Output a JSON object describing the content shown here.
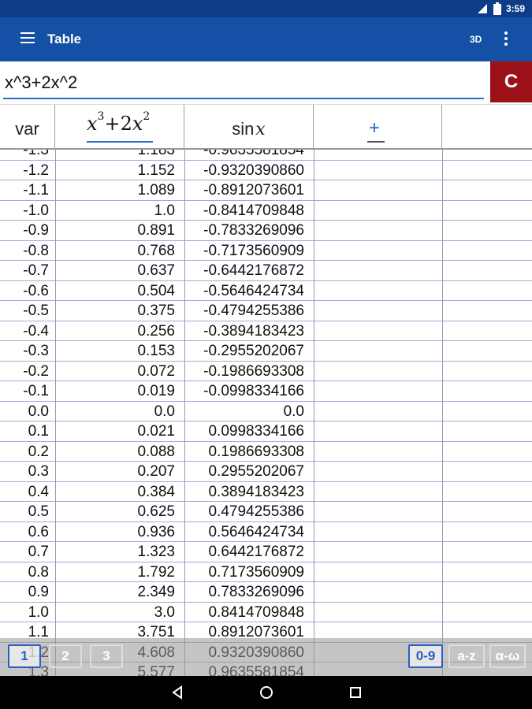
{
  "status": {
    "time": "3:59",
    "network": "3G"
  },
  "appbar": {
    "title": "Table",
    "btn_3d": "3D"
  },
  "input": {
    "expression": "x^3+2x^2",
    "clear_label": "C"
  },
  "header": {
    "var_label": "var",
    "col1_formula": {
      "base1": "x",
      "exp1": "3",
      "op": "+2",
      "base2": "x",
      "exp2": "2"
    },
    "col2_formula": {
      "fn": "sin",
      "arg": "x"
    },
    "add_label": "+"
  },
  "rows": [
    {
      "var": "-1.3",
      "f1": "1.183",
      "f2": "-0.9635581854"
    },
    {
      "var": "-1.2",
      "f1": "1.152",
      "f2": "-0.9320390860"
    },
    {
      "var": "-1.1",
      "f1": "1.089",
      "f2": "-0.8912073601"
    },
    {
      "var": "-1.0",
      "f1": "1.0",
      "f2": "-0.8414709848"
    },
    {
      "var": "-0.9",
      "f1": "0.891",
      "f2": "-0.7833269096"
    },
    {
      "var": "-0.8",
      "f1": "0.768",
      "f2": "-0.7173560909"
    },
    {
      "var": "-0.7",
      "f1": "0.637",
      "f2": "-0.6442176872"
    },
    {
      "var": "-0.6",
      "f1": "0.504",
      "f2": "-0.5646424734"
    },
    {
      "var": "-0.5",
      "f1": "0.375",
      "f2": "-0.4794255386"
    },
    {
      "var": "-0.4",
      "f1": "0.256",
      "f2": "-0.3894183423"
    },
    {
      "var": "-0.3",
      "f1": "0.153",
      "f2": "-0.2955202067"
    },
    {
      "var": "-0.2",
      "f1": "0.072",
      "f2": "-0.1986693308"
    },
    {
      "var": "-0.1",
      "f1": "0.019",
      "f2": "-0.0998334166"
    },
    {
      "var": "0.0",
      "f1": "0.0",
      "f2": "0.0"
    },
    {
      "var": "0.1",
      "f1": "0.021",
      "f2": "0.0998334166"
    },
    {
      "var": "0.2",
      "f1": "0.088",
      "f2": "0.1986693308"
    },
    {
      "var": "0.3",
      "f1": "0.207",
      "f2": "0.2955202067"
    },
    {
      "var": "0.4",
      "f1": "0.384",
      "f2": "0.3894183423"
    },
    {
      "var": "0.5",
      "f1": "0.625",
      "f2": "0.4794255386"
    },
    {
      "var": "0.6",
      "f1": "0.936",
      "f2": "0.5646424734"
    },
    {
      "var": "0.7",
      "f1": "1.323",
      "f2": "0.6442176872"
    },
    {
      "var": "0.8",
      "f1": "1.792",
      "f2": "0.7173560909"
    },
    {
      "var": "0.9",
      "f1": "2.349",
      "f2": "0.7833269096"
    },
    {
      "var": "1.0",
      "f1": "3.0",
      "f2": "0.8414709848"
    },
    {
      "var": "1.1",
      "f1": "3.751",
      "f2": "0.8912073601"
    },
    {
      "var": "1.2",
      "f1": "4.608",
      "f2": "0.9320390860"
    },
    {
      "var": "1.3",
      "f1": "5.577",
      "f2": "0.9635581854"
    }
  ],
  "keyboard_tabs": {
    "tab1": "1",
    "tab2": "2",
    "tab3": "3",
    "digits": "0-9",
    "letters": "a-z",
    "greek": "α-ω"
  }
}
